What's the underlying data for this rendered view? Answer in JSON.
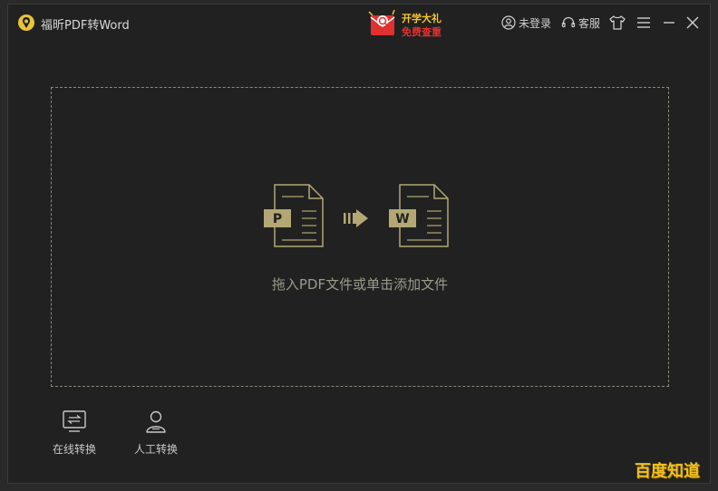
{
  "app": {
    "title": "福昕PDF转Word"
  },
  "promo": {
    "line1": "开学大礼",
    "line2": "免费查重"
  },
  "toolbar": {
    "login_label": "未登录",
    "service_label": "客服"
  },
  "dropzone": {
    "hint": "拖入PDF文件或单击添加文件",
    "source_letter": "P",
    "target_letter": "W"
  },
  "modes": [
    {
      "label": "在线转换"
    },
    {
      "label": "人工转换"
    }
  ],
  "watermark": {
    "text": "百度知道"
  },
  "colors": {
    "accent": "#c8b97a",
    "icon_gold": "#b3a774",
    "promo_red": "#e0312f",
    "promo_yellow": "#f4c430"
  }
}
